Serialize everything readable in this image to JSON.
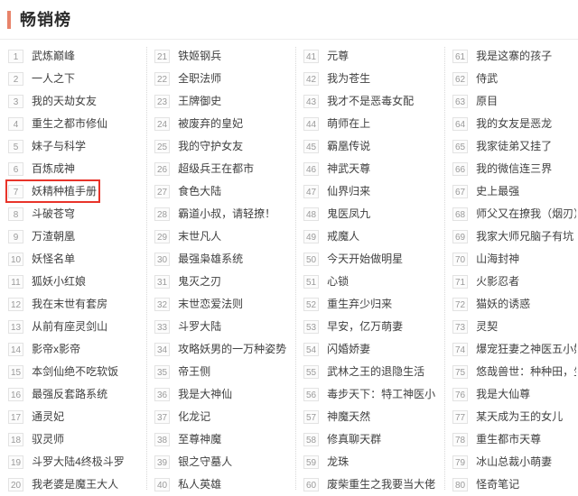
{
  "header": {
    "title": "畅销榜",
    "accent_color": "#e8836a"
  },
  "highlight": {
    "rank": "7",
    "title": "妖精种植手册",
    "border_color": "#e8342a"
  },
  "columns": [
    {
      "items": [
        {
          "rank": "1",
          "title": "武炼巅峰"
        },
        {
          "rank": "2",
          "title": "一人之下"
        },
        {
          "rank": "3",
          "title": "我的天劫女友"
        },
        {
          "rank": "4",
          "title": "重生之都市修仙"
        },
        {
          "rank": "5",
          "title": "妹子与科学"
        },
        {
          "rank": "6",
          "title": "百炼成神"
        },
        {
          "rank": "7",
          "title": "妖精种植手册"
        },
        {
          "rank": "8",
          "title": "斗破苍穹"
        },
        {
          "rank": "9",
          "title": "万渣朝凰"
        },
        {
          "rank": "10",
          "title": "妖怪名单"
        },
        {
          "rank": "11",
          "title": "狐妖小红娘"
        },
        {
          "rank": "12",
          "title": "我在末世有套房"
        },
        {
          "rank": "13",
          "title": "从前有座灵剑山"
        },
        {
          "rank": "14",
          "title": "影帝x影帝"
        },
        {
          "rank": "15",
          "title": "本剑仙绝不吃软饭"
        },
        {
          "rank": "16",
          "title": "最强反套路系统"
        },
        {
          "rank": "17",
          "title": "通灵妃"
        },
        {
          "rank": "18",
          "title": "驭灵师"
        },
        {
          "rank": "19",
          "title": "斗罗大陆4终极斗罗"
        },
        {
          "rank": "20",
          "title": "我老婆是魔王大人"
        }
      ]
    },
    {
      "items": [
        {
          "rank": "21",
          "title": "铁姬钢兵"
        },
        {
          "rank": "22",
          "title": "全职法师"
        },
        {
          "rank": "23",
          "title": "王牌御史"
        },
        {
          "rank": "24",
          "title": "被废弃的皇妃"
        },
        {
          "rank": "25",
          "title": "我的守护女友"
        },
        {
          "rank": "26",
          "title": "超级兵王在都市"
        },
        {
          "rank": "27",
          "title": "食色大陆"
        },
        {
          "rank": "28",
          "title": "霸道小叔，请轻撩！"
        },
        {
          "rank": "29",
          "title": "末世凡人"
        },
        {
          "rank": "30",
          "title": "最强枭雄系统"
        },
        {
          "rank": "31",
          "title": "鬼灭之刃"
        },
        {
          "rank": "32",
          "title": "末世恋爱法则"
        },
        {
          "rank": "33",
          "title": "斗罗大陆"
        },
        {
          "rank": "34",
          "title": "攻略妖男的一万种姿势"
        },
        {
          "rank": "35",
          "title": "帝王侧"
        },
        {
          "rank": "36",
          "title": "我是大神仙"
        },
        {
          "rank": "37",
          "title": "化龙记"
        },
        {
          "rank": "38",
          "title": "至尊神魔"
        },
        {
          "rank": "39",
          "title": "银之守墓人"
        },
        {
          "rank": "40",
          "title": "私人英雄"
        }
      ]
    },
    {
      "items": [
        {
          "rank": "41",
          "title": "元尊"
        },
        {
          "rank": "42",
          "title": "我为苍生"
        },
        {
          "rank": "43",
          "title": "我才不是恶毒女配"
        },
        {
          "rank": "44",
          "title": "萌师在上"
        },
        {
          "rank": "45",
          "title": "霸凰传说"
        },
        {
          "rank": "46",
          "title": "神武天尊"
        },
        {
          "rank": "47",
          "title": "仙界归来"
        },
        {
          "rank": "48",
          "title": "鬼医凤九"
        },
        {
          "rank": "49",
          "title": "戒魔人"
        },
        {
          "rank": "50",
          "title": "今天开始做明星"
        },
        {
          "rank": "51",
          "title": "心锁"
        },
        {
          "rank": "52",
          "title": "重生弃少归来"
        },
        {
          "rank": "53",
          "title": "早安，亿万萌妻"
        },
        {
          "rank": "54",
          "title": "闪婚娇妻"
        },
        {
          "rank": "55",
          "title": "武林之王的退隐生活"
        },
        {
          "rank": "56",
          "title": "毒步天下：特工神医小"
        },
        {
          "rank": "57",
          "title": "神魔天然"
        },
        {
          "rank": "58",
          "title": "修真聊天群"
        },
        {
          "rank": "59",
          "title": "龙珠"
        },
        {
          "rank": "60",
          "title": "废柴重生之我要当大佬"
        }
      ]
    },
    {
      "items": [
        {
          "rank": "61",
          "title": "我是这寨的孩子"
        },
        {
          "rank": "62",
          "title": "侍武"
        },
        {
          "rank": "63",
          "title": "原目"
        },
        {
          "rank": "64",
          "title": "我的女友是恶龙"
        },
        {
          "rank": "65",
          "title": "我家徒弟又挂了"
        },
        {
          "rank": "66",
          "title": "我的微信连三界"
        },
        {
          "rank": "67",
          "title": "史上最强"
        },
        {
          "rank": "68",
          "title": "师父又在撩我（烟刃）"
        },
        {
          "rank": "69",
          "title": "我家大师兄脑子有坑"
        },
        {
          "rank": "70",
          "title": "山海封神"
        },
        {
          "rank": "71",
          "title": "火影忍者"
        },
        {
          "rank": "72",
          "title": "猫妖的诱惑"
        },
        {
          "rank": "73",
          "title": "灵契"
        },
        {
          "rank": "74",
          "title": "爆宠狂妻之神医五小姐"
        },
        {
          "rank": "75",
          "title": "悠哉兽世：种种田，生"
        },
        {
          "rank": "76",
          "title": "我是大仙尊"
        },
        {
          "rank": "77",
          "title": "某天成为王的女儿"
        },
        {
          "rank": "78",
          "title": "重生都市天尊"
        },
        {
          "rank": "79",
          "title": "冰山总裁小萌妻"
        },
        {
          "rank": "80",
          "title": "怪奇笔记"
        }
      ]
    }
  ]
}
